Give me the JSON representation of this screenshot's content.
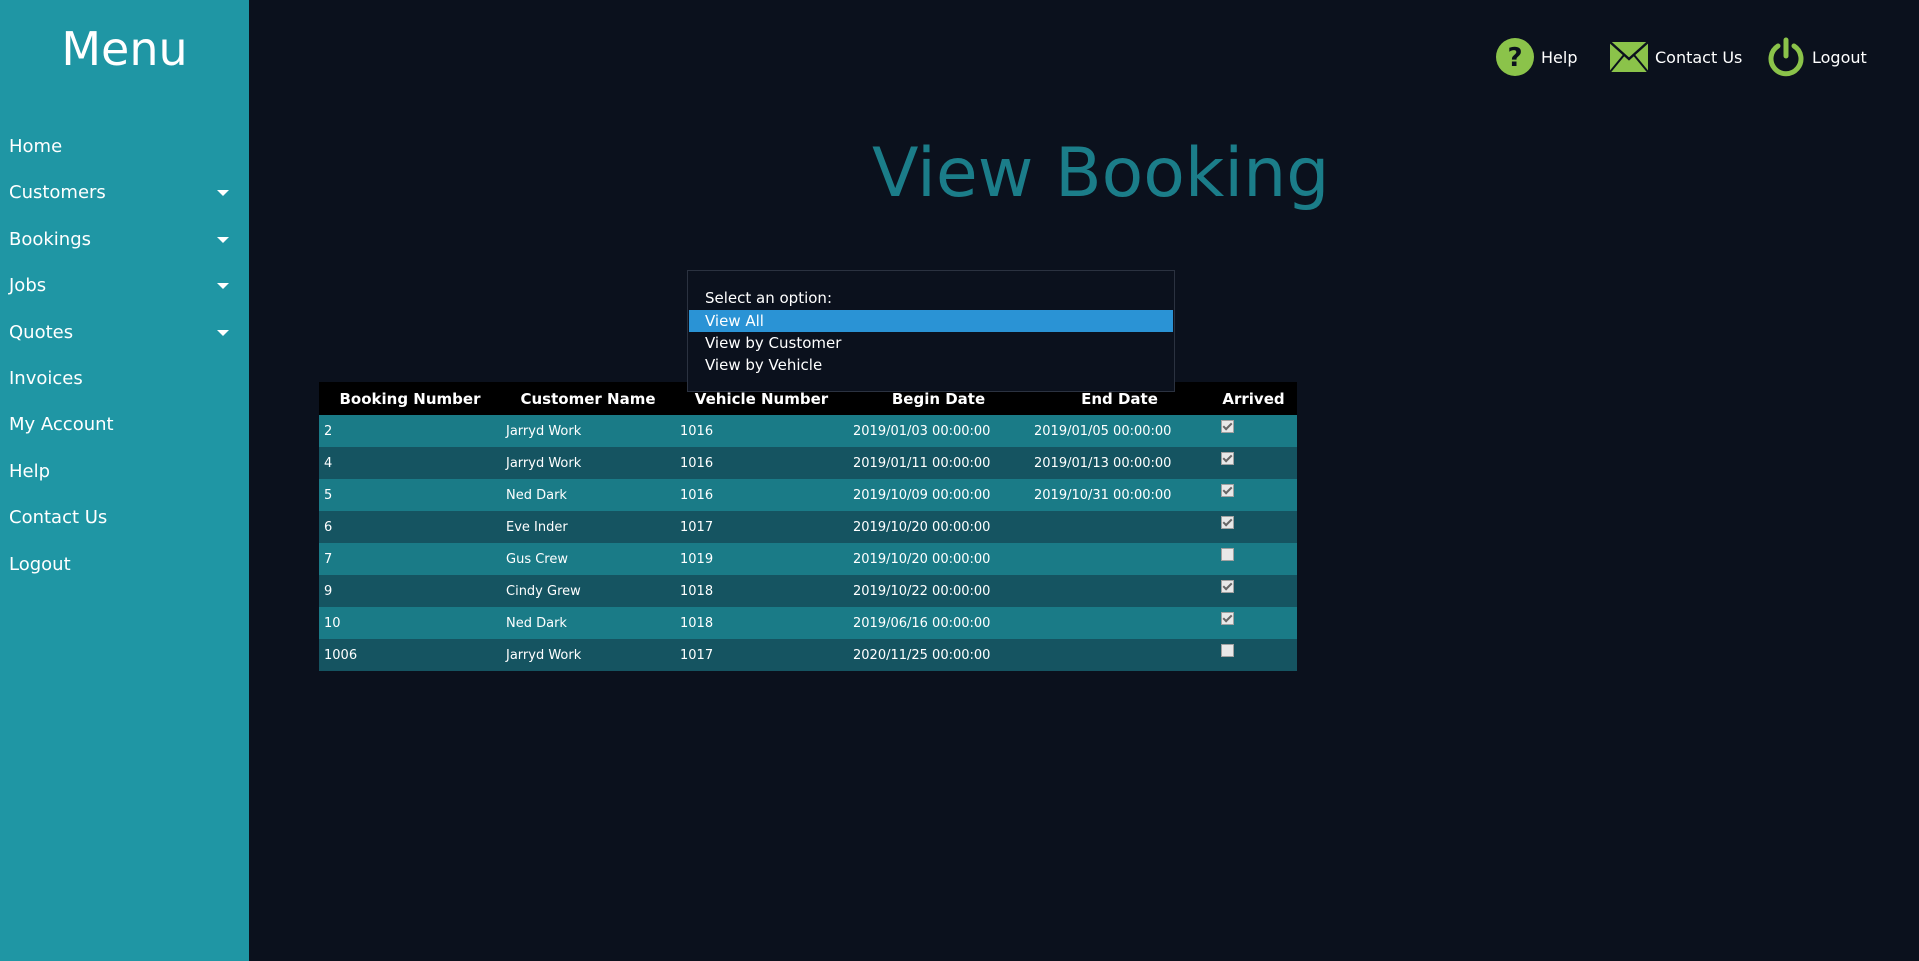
{
  "sidebar": {
    "title": "Menu",
    "items": [
      {
        "label": "Home",
        "has_dropdown": false
      },
      {
        "label": "Customers",
        "has_dropdown": true
      },
      {
        "label": "Bookings",
        "has_dropdown": true
      },
      {
        "label": "Jobs",
        "has_dropdown": true
      },
      {
        "label": "Quotes",
        "has_dropdown": true
      },
      {
        "label": "Invoices",
        "has_dropdown": false
      },
      {
        "label": "My Account",
        "has_dropdown": false
      },
      {
        "label": "Help",
        "has_dropdown": false
      },
      {
        "label": "Contact Us",
        "has_dropdown": false
      },
      {
        "label": "Logout",
        "has_dropdown": false
      }
    ]
  },
  "header": {
    "help_label": "Help",
    "contact_label": "Contact Us",
    "logout_label": "Logout",
    "icons": {
      "help": "question-circle-icon",
      "contact": "envelope-icon",
      "logout": "power-icon"
    },
    "icon_color": "#8bc34a"
  },
  "main": {
    "page_title": "View Booking",
    "select": {
      "label": "Select an option:",
      "options": [
        "View All",
        "View by Customer",
        "View by Vehicle"
      ],
      "selected": "View All"
    },
    "table": {
      "columns": [
        "Booking Number",
        "Customer Name",
        "Vehicle Number",
        "Begin Date",
        "End Date",
        "Arrived"
      ],
      "rows": [
        {
          "booking": "2",
          "customer": "Jarryd Work",
          "vehicle": "1016",
          "begin": "2019/01/03 00:00:00",
          "end": "2019/01/05 00:00:00",
          "arrived": true
        },
        {
          "booking": "4",
          "customer": "Jarryd Work",
          "vehicle": "1016",
          "begin": "2019/01/11 00:00:00",
          "end": "2019/01/13 00:00:00",
          "arrived": true
        },
        {
          "booking": "5",
          "customer": "Ned Dark",
          "vehicle": "1016",
          "begin": "2019/10/09 00:00:00",
          "end": "2019/10/31 00:00:00",
          "arrived": true
        },
        {
          "booking": "6",
          "customer": "Eve Inder",
          "vehicle": "1017",
          "begin": "2019/10/20 00:00:00",
          "end": "",
          "arrived": true
        },
        {
          "booking": "7",
          "customer": "Gus Crew",
          "vehicle": "1019",
          "begin": "2019/10/20 00:00:00",
          "end": "",
          "arrived": false
        },
        {
          "booking": "9",
          "customer": "Cindy Grew",
          "vehicle": "1018",
          "begin": "2019/10/22 00:00:00",
          "end": "",
          "arrived": true
        },
        {
          "booking": "10",
          "customer": "Ned Dark",
          "vehicle": "1018",
          "begin": "2019/06/16 00:00:00",
          "end": "",
          "arrived": true
        },
        {
          "booking": "1006",
          "customer": "Jarryd Work",
          "vehicle": "1017",
          "begin": "2020/11/25 00:00:00",
          "end": "",
          "arrived": false
        }
      ]
    }
  },
  "colors": {
    "sidebar_bg": "#1f96a4",
    "page_bg": "#0b111d",
    "title_color": "#1b7d89",
    "row_odd": "#1a7b87",
    "row_even": "#155461",
    "selected_option": "#2a93d5"
  }
}
